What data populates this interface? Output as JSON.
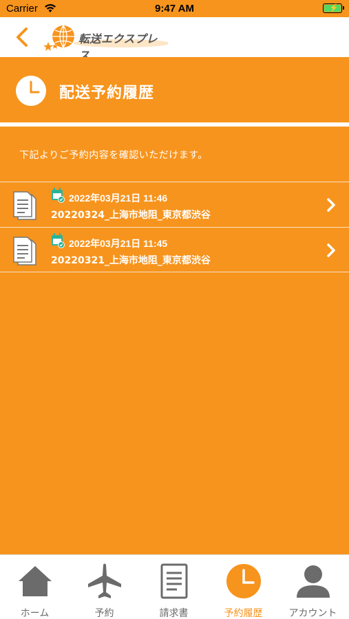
{
  "status_bar": {
    "carrier": "Carrier",
    "time": "9:47 AM",
    "battery_level": 1.0
  },
  "nav": {
    "logo_text": "転送エクスプレス",
    "back_icon": "chevron-left-icon"
  },
  "header": {
    "title": "配送予約履歴",
    "icon": "clock-icon"
  },
  "instruction": "下記よりご予約内容を確認いただけます。",
  "history": [
    {
      "date": "2022年03月21日 11:46",
      "route": "20220324_上海市地阻_東京都渋谷"
    },
    {
      "date": "2022年03月21日 11:45",
      "route": "20220321_上海市地阻_東京都渋谷"
    }
  ],
  "tabs": [
    {
      "label": "ホーム",
      "icon": "home-icon",
      "active": false
    },
    {
      "label": "予約",
      "icon": "airplane-icon",
      "active": false
    },
    {
      "label": "請求書",
      "icon": "invoice-icon",
      "active": false
    },
    {
      "label": "予約履歴",
      "icon": "clock-icon",
      "active": true
    },
    {
      "label": "アカウント",
      "icon": "user-icon",
      "active": false
    }
  ],
  "colors": {
    "brand": "#F7941D",
    "white": "#FFFFFF",
    "tab_inactive": "#6B6B6B",
    "calendar_green": "#2BB39A"
  }
}
